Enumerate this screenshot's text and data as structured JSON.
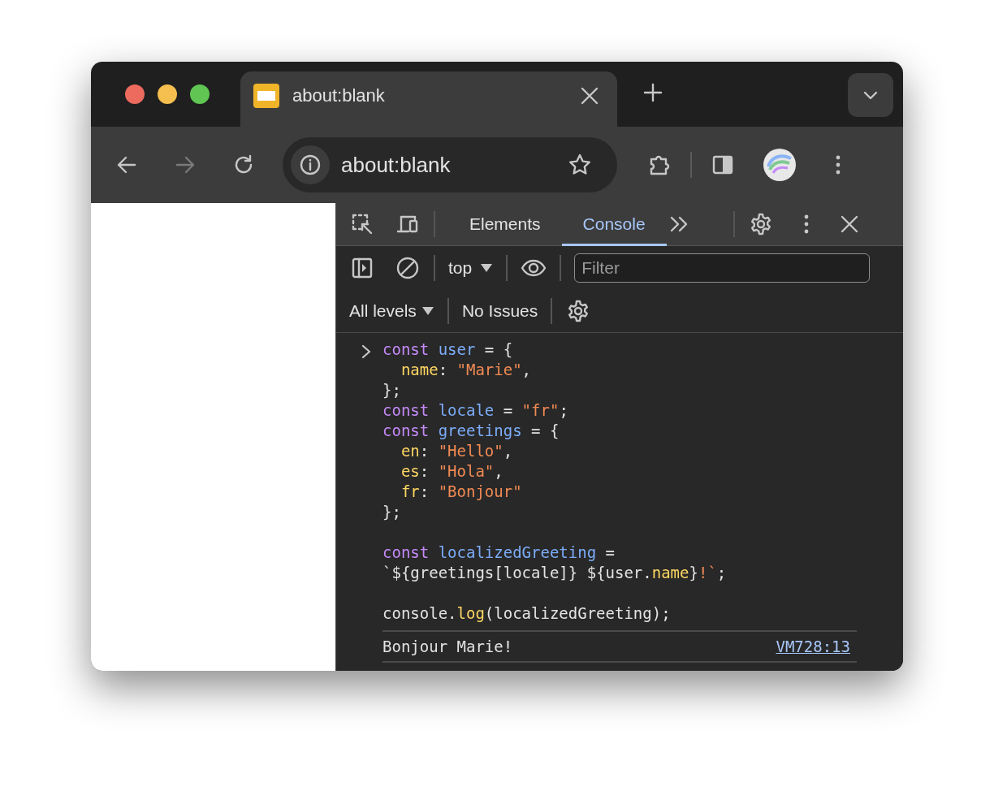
{
  "browser_tabs": [
    {
      "title": "about:blank",
      "selected": true
    }
  ],
  "address_bar": {
    "url": "about:blank"
  },
  "devtools": {
    "tabs": [
      {
        "label": "Elements",
        "selected": false
      },
      {
        "label": "Console",
        "selected": true
      }
    ],
    "context": "top",
    "filter": {
      "placeholder": "Filter"
    },
    "levels": "All levels",
    "issues": "No Issues",
    "console": {
      "input_lines": [
        {
          "blank_before": false,
          "indented": false,
          "tokens": [
            {
              "kind": "keyword",
              "text": "const "
            },
            {
              "kind": "variable",
              "text": "user"
            },
            {
              "kind": "plain",
              "text": " = {"
            }
          ]
        },
        {
          "blank_before": false,
          "indented": true,
          "tokens": [
            {
              "kind": "property",
              "text": "name"
            },
            {
              "kind": "plain",
              "text": ": "
            },
            {
              "kind": "string",
              "text": "\"Marie\""
            },
            {
              "kind": "plain",
              "text": ","
            }
          ]
        },
        {
          "blank_before": false,
          "indented": false,
          "tokens": [
            {
              "kind": "plain",
              "text": "};"
            }
          ]
        },
        {
          "blank_before": false,
          "indented": false,
          "tokens": [
            {
              "kind": "keyword",
              "text": "const "
            },
            {
              "kind": "variable",
              "text": "locale"
            },
            {
              "kind": "plain",
              "text": " = "
            },
            {
              "kind": "string",
              "text": "\"fr\""
            },
            {
              "kind": "plain",
              "text": ";"
            }
          ]
        },
        {
          "blank_before": false,
          "indented": false,
          "tokens": [
            {
              "kind": "keyword",
              "text": "const "
            },
            {
              "kind": "variable",
              "text": "greetings"
            },
            {
              "kind": "plain",
              "text": " = {"
            }
          ]
        },
        {
          "blank_before": false,
          "indented": true,
          "tokens": [
            {
              "kind": "property",
              "text": "en"
            },
            {
              "kind": "plain",
              "text": ": "
            },
            {
              "kind": "string",
              "text": "\"Hello\""
            },
            {
              "kind": "plain",
              "text": ","
            }
          ]
        },
        {
          "blank_before": false,
          "indented": true,
          "tokens": [
            {
              "kind": "property",
              "text": "es"
            },
            {
              "kind": "plain",
              "text": ": "
            },
            {
              "kind": "string",
              "text": "\"Hola\""
            },
            {
              "kind": "plain",
              "text": ","
            }
          ]
        },
        {
          "blank_before": false,
          "indented": true,
          "tokens": [
            {
              "kind": "property",
              "text": "fr"
            },
            {
              "kind": "plain",
              "text": ": "
            },
            {
              "kind": "string",
              "text": "\"Bonjour\""
            }
          ]
        },
        {
          "blank_before": false,
          "indented": false,
          "tokens": [
            {
              "kind": "plain",
              "text": "};"
            }
          ]
        },
        {
          "blank_before": true,
          "indented": false,
          "tokens": [
            {
              "kind": "keyword",
              "text": "const "
            },
            {
              "kind": "variable",
              "text": "localizedGreeting"
            },
            {
              "kind": "plain",
              "text": " ="
            }
          ]
        },
        {
          "blank_before": false,
          "indented": false,
          "tokens": [
            {
              "kind": "plain",
              "text": "`${greetings[locale]} ${user."
            },
            {
              "kind": "property",
              "text": "name"
            },
            {
              "kind": "plain",
              "text": "}"
            },
            {
              "kind": "string",
              "text": "!`"
            },
            {
              "kind": "plain",
              "text": ";"
            }
          ]
        },
        {
          "blank_before": true,
          "indented": false,
          "tokens": [
            {
              "kind": "plain",
              "text": "console."
            },
            {
              "kind": "property",
              "text": "log"
            },
            {
              "kind": "plain",
              "text": "(localizedGreeting);"
            }
          ]
        }
      ],
      "output": {
        "text": "Bonjour Marie!",
        "source": "VM728:13"
      }
    }
  }
}
